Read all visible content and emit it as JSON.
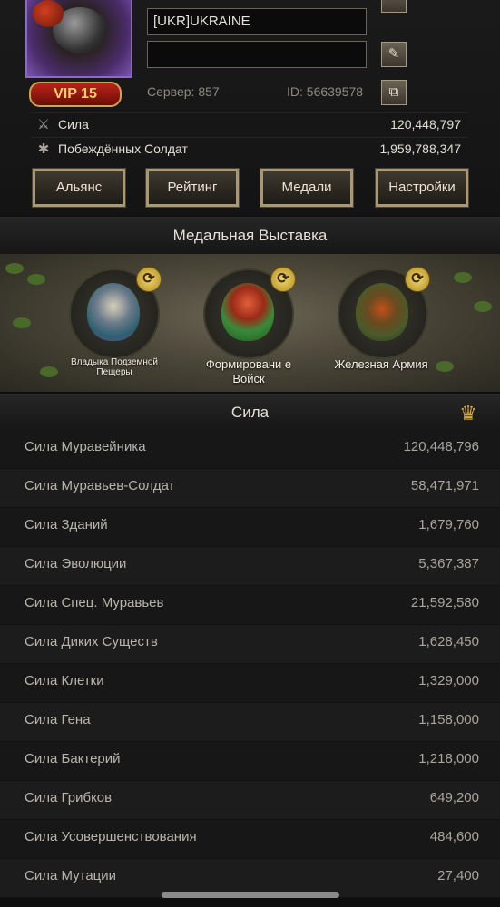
{
  "profile": {
    "vip_label": "VIP 15",
    "alliance_name": "[UKR]UKRAINE",
    "signature_value": "",
    "server_text": "Сервер: 857",
    "id_text": "ID: 56639578"
  },
  "stats": [
    {
      "icon": "crossed-swords-icon",
      "label": "Сила",
      "value": "120,448,797"
    },
    {
      "icon": "ant-icon",
      "label": "Побеждённых Солдат",
      "value": "1,959,788,347"
    }
  ],
  "buttons": {
    "alliance": "Альянс",
    "ranking": "Рейтинг",
    "medals": "Медали",
    "settings": "Настройки"
  },
  "medal_showcase": {
    "title": "Медальная Выставка",
    "medals": [
      {
        "name": "Владыка Подземной Пещеры"
      },
      {
        "name": "Формировани е Войск"
      },
      {
        "name": "Железная Армия"
      }
    ]
  },
  "power": {
    "title": "Сила",
    "rows": [
      {
        "label": "Сила Муравейника",
        "value": "120,448,796"
      },
      {
        "label": "Сила Муравьев-Солдат",
        "value": "58,471,971"
      },
      {
        "label": "Сила Зданий",
        "value": "1,679,760"
      },
      {
        "label": "Сила Эволюции",
        "value": "5,367,387"
      },
      {
        "label": "Сила Спец. Муравьев",
        "value": "21,592,580"
      },
      {
        "label": "Сила Диких Существ",
        "value": "1,628,450"
      },
      {
        "label": "Сила Клетки",
        "value": "1,329,000"
      },
      {
        "label": "Сила Гена",
        "value": "1,158,000"
      },
      {
        "label": "Сила Бактерий",
        "value": "1,218,000"
      },
      {
        "label": "Сила Грибков",
        "value": "649,200"
      },
      {
        "label": "Сила Усовершенствования",
        "value": "484,600"
      },
      {
        "label": "Сила Мутации",
        "value": "27,400"
      }
    ]
  },
  "colors": {
    "gold_border": "#a99874",
    "vip_red": "#b82418",
    "vip_text": "#f3d36b",
    "trophy": "#d7ad3a"
  }
}
